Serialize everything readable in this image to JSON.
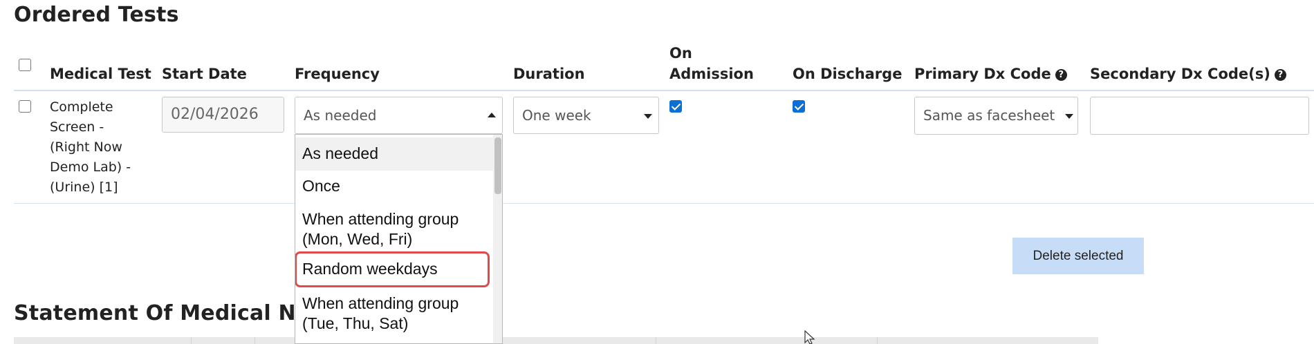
{
  "ordered_tests": {
    "title": "Ordered Tests",
    "headers": {
      "medical_test": "Medical Test",
      "start_date": "Start Date",
      "frequency": "Frequency",
      "duration": "Duration",
      "on_admission_line1": "On",
      "on_admission_line2": "Admission",
      "on_discharge": "On Discharge",
      "primary_dx": "Primary Dx Code",
      "secondary_dx": "Secondary Dx Code(s)"
    },
    "row": {
      "test_lines": [
        "Complete",
        "Screen -",
        "(Right Now",
        "Demo Lab) -",
        "(Urine) [1]"
      ],
      "start_date": "02/04/2026",
      "frequency": "As needed",
      "duration": "One week",
      "on_admission": true,
      "on_discharge": true,
      "primary_dx": "Same as facesheet",
      "secondary_dx": ""
    },
    "frequency_options": [
      {
        "lines": [
          "As needed"
        ],
        "highlighted": true
      },
      {
        "lines": [
          "Once"
        ]
      },
      {
        "lines": [
          "When attending group",
          "(Mon, Wed, Fri)"
        ]
      },
      {
        "lines": [
          "Random weekdays"
        ],
        "outlined": true
      },
      {
        "lines": [
          "When attending group",
          "(Tue, Thu, Sat)"
        ]
      }
    ],
    "delete_label": "Delete selected"
  },
  "statement": {
    "title_visible": "Statement Of Medical Ne"
  },
  "colors": {
    "accent": "#0b6fd6",
    "button_bg": "#c7dcf6",
    "outline": "#e04a4a"
  }
}
